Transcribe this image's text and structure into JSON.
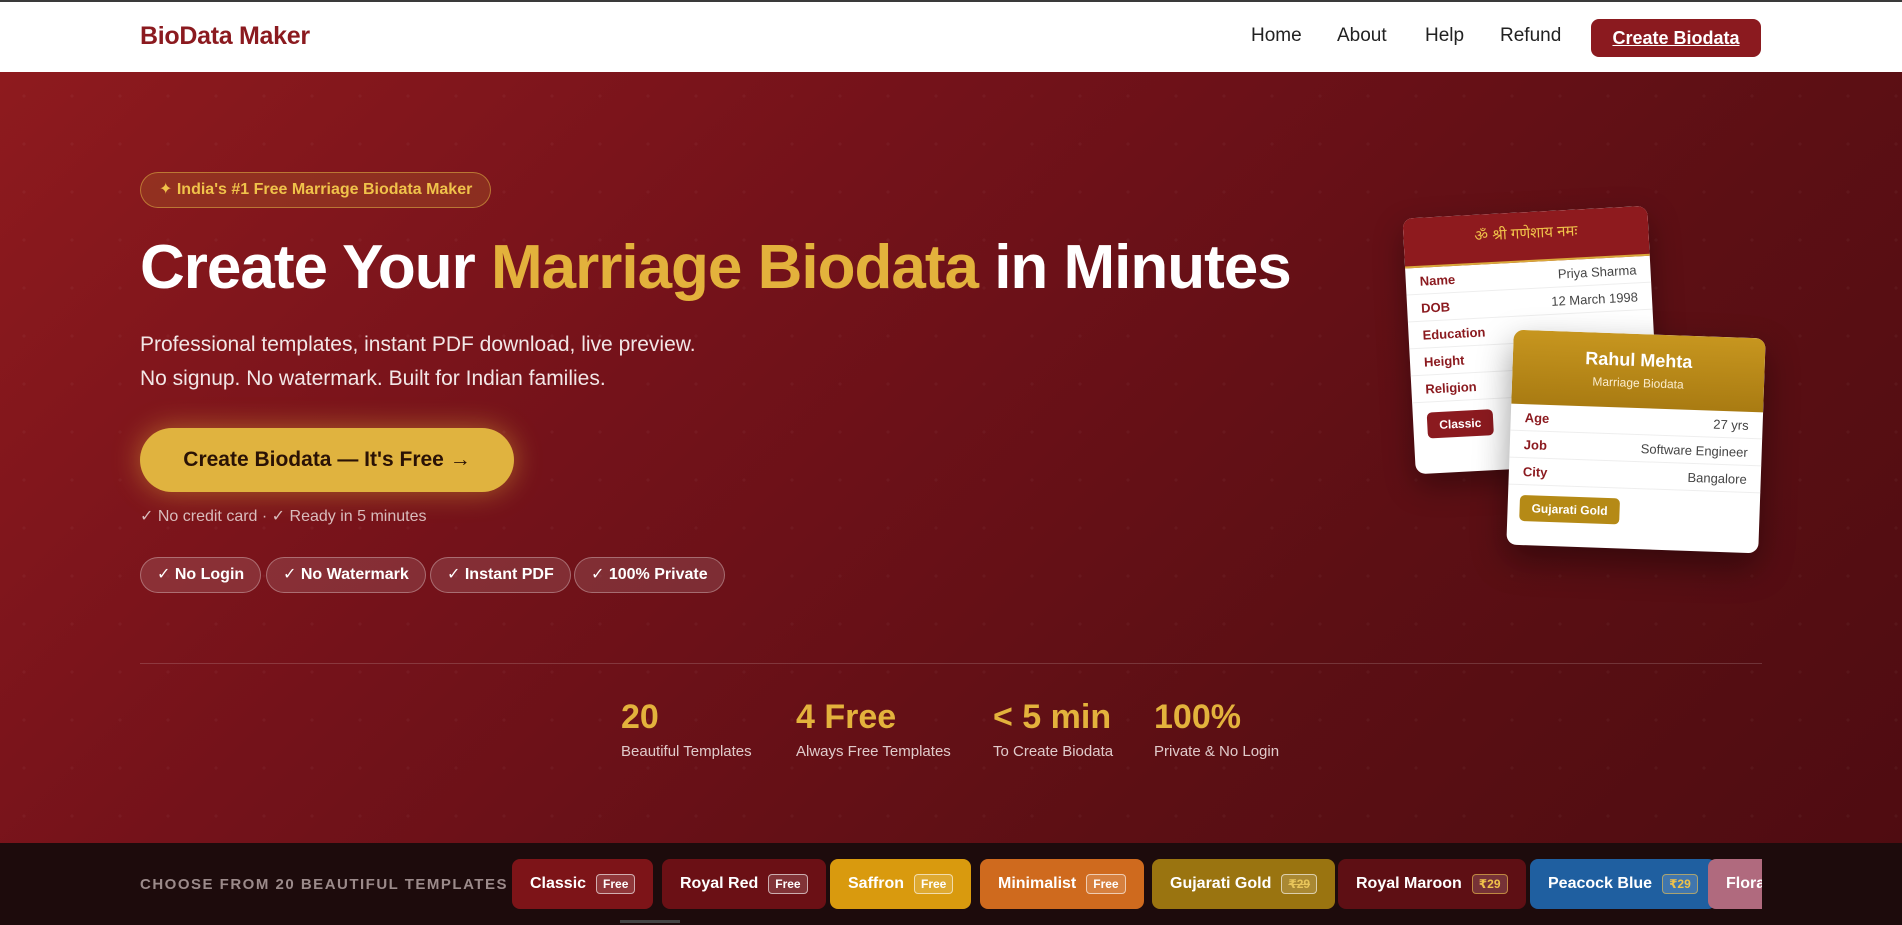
{
  "nav": {
    "logo": "BioData Maker",
    "links": [
      "Home",
      "About",
      "Help",
      "Refund"
    ],
    "cta": "Create Biodata"
  },
  "hero": {
    "badge": "✦ India's #1 Free Marriage Biodata Maker",
    "title_pre": "Create Your ",
    "title_accent": "Marriage Biodata",
    "title_post": " in Minutes",
    "sub_line1": "Professional templates, instant PDF download, live preview.",
    "sub_line2": "No signup. No watermark. Built for Indian families.",
    "cta": "Create Biodata — It's Free →",
    "note": "✓ No credit card  ·  ✓ Ready in 5 minutes",
    "pills": [
      "✓ No Login",
      "✓ No Watermark",
      "✓ Instant PDF",
      "✓ 100% Private"
    ]
  },
  "stats": [
    {
      "num": "20",
      "label": "Beautiful Templates"
    },
    {
      "num": "4 Free",
      "label": "Always Free Templates"
    },
    {
      "num": "< 5 min",
      "label": "To Create Biodata"
    },
    {
      "num": "100%",
      "label": "Private & No Login"
    }
  ],
  "card_back": {
    "header": "ॐ श्री गणेशाय नमः",
    "rows": [
      {
        "k": "Name",
        "v": "Priya Sharma"
      },
      {
        "k": "DOB",
        "v": "12 March 1998"
      },
      {
        "k": "Education",
        "v": ""
      },
      {
        "k": "Height",
        "v": ""
      },
      {
        "k": "Religion",
        "v": ""
      }
    ],
    "tag": "Classic"
  },
  "card_front": {
    "name": "Rahul Mehta",
    "sub": "Marriage Biodata",
    "rows": [
      {
        "k": "Age",
        "v": "27 yrs"
      },
      {
        "k": "Job",
        "v": "Software Engineer"
      },
      {
        "k": "City",
        "v": "Bangalore"
      }
    ],
    "tag": "Gujarati Gold"
  },
  "templates": {
    "label": "CHOOSE FROM 20 BEAUTIFUL TEMPLATES",
    "chips": [
      {
        "name": "Classic",
        "price": "Free",
        "color": "#7d1418"
      },
      {
        "name": "Royal Red",
        "price": "Free",
        "color": "#6b1015"
      },
      {
        "name": "Saffron",
        "price": "Free",
        "color": "#d99a0e"
      },
      {
        "name": "Minimalist",
        "price": "Free",
        "color": "#cf6a1e"
      },
      {
        "name": "Gujarati Gold",
        "price": "₹29",
        "color": "#9a7410"
      },
      {
        "name": "Royal Maroon",
        "price": "₹29",
        "color": "#5e0f14"
      },
      {
        "name": "Peacock Blue",
        "price": "₹29",
        "color": "#1f5fa0"
      },
      {
        "name": "Floral",
        "price": "",
        "color": "#b06a7e"
      }
    ]
  }
}
